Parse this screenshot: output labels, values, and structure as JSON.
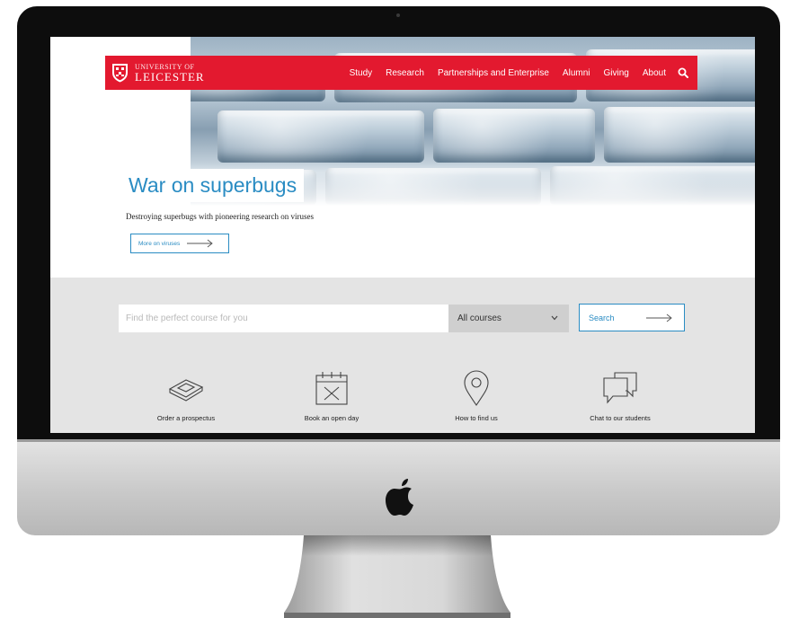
{
  "site": {
    "logo": {
      "line1": "UNIVERSITY OF",
      "line2": "LEICESTER"
    },
    "nav": {
      "links": [
        {
          "label": "Study"
        },
        {
          "label": "Research"
        },
        {
          "label": "Partnerships and Enterprise"
        },
        {
          "label": "Alumni"
        },
        {
          "label": "Giving"
        },
        {
          "label": "About"
        }
      ]
    },
    "hero": {
      "headline": "War on superbugs",
      "subhead": "Destroying superbugs with pioneering research on viruses",
      "cta_label": "More on viruses"
    },
    "course_search": {
      "placeholder": "Find the perfect course for you",
      "value": "",
      "selected_option": "All courses",
      "button_label": "Search"
    },
    "quick_links": [
      {
        "label": "Order a prospectus",
        "icon": "book-icon"
      },
      {
        "label": "Book an open day",
        "icon": "calendar-icon"
      },
      {
        "label": "How to find us",
        "icon": "map-pin-icon"
      },
      {
        "label": "Chat to our students",
        "icon": "chat-bubbles-icon"
      }
    ]
  },
  "colors": {
    "brand_red": "#e3192f",
    "accent_blue": "#2a8cc3",
    "band_grey": "#e4e4e4",
    "select_grey": "#cfcfcf"
  }
}
